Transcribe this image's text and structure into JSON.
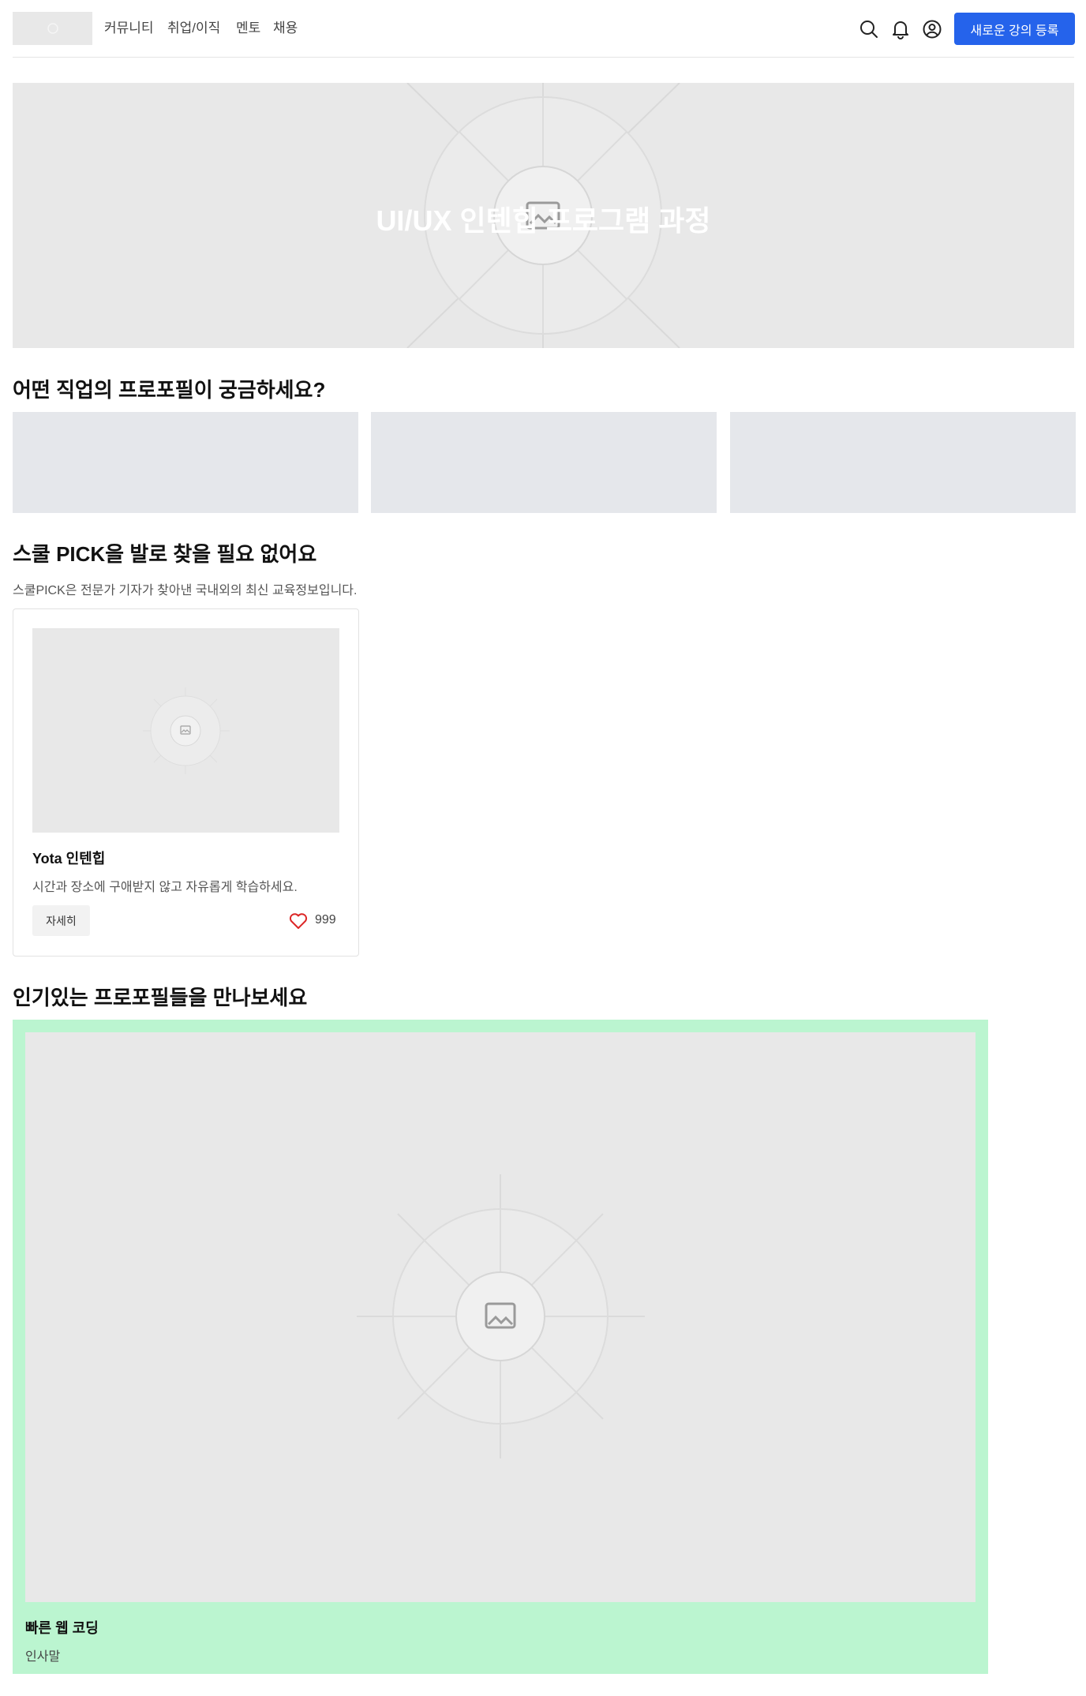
{
  "header": {
    "nav": [
      "커뮤니티",
      "취업/이직",
      "멘토",
      "채용"
    ],
    "icons": [
      "search-icon",
      "bell-icon",
      "user-circle-icon"
    ],
    "cta_label": "새로운 강의 등록",
    "accent_color": "#2563eb"
  },
  "hero": {
    "title": "UI/UX 인텐힙 프로그램 과정",
    "background_color": "#e8e8e8"
  },
  "jobs_section": {
    "title": "어떤 직업의 프로포필이 궁금하세요?",
    "card_count": 3,
    "card_color": "#e5e7eb"
  },
  "pick_section": {
    "title": "스쿨 PICK을 발로 찾을 필요 없어요",
    "description": "스쿨PICK은 전문가 기자가 찾아낸 국내외의 최신 교육정보입니다.",
    "card": {
      "title": "Yota 인텐힙",
      "description": "시간과 장소에 구애받지 않고 자유롭게 학습하세요.",
      "detail_label": "자세히",
      "like_count": "999",
      "heart_color": "#dc2626"
    }
  },
  "popular_section": {
    "title": "인기있는 프로포필들을 만나보세요",
    "background_color": "#bbf5d0",
    "profile": {
      "name": "빠른 웹 코딩",
      "subtitle": "인사말"
    }
  }
}
